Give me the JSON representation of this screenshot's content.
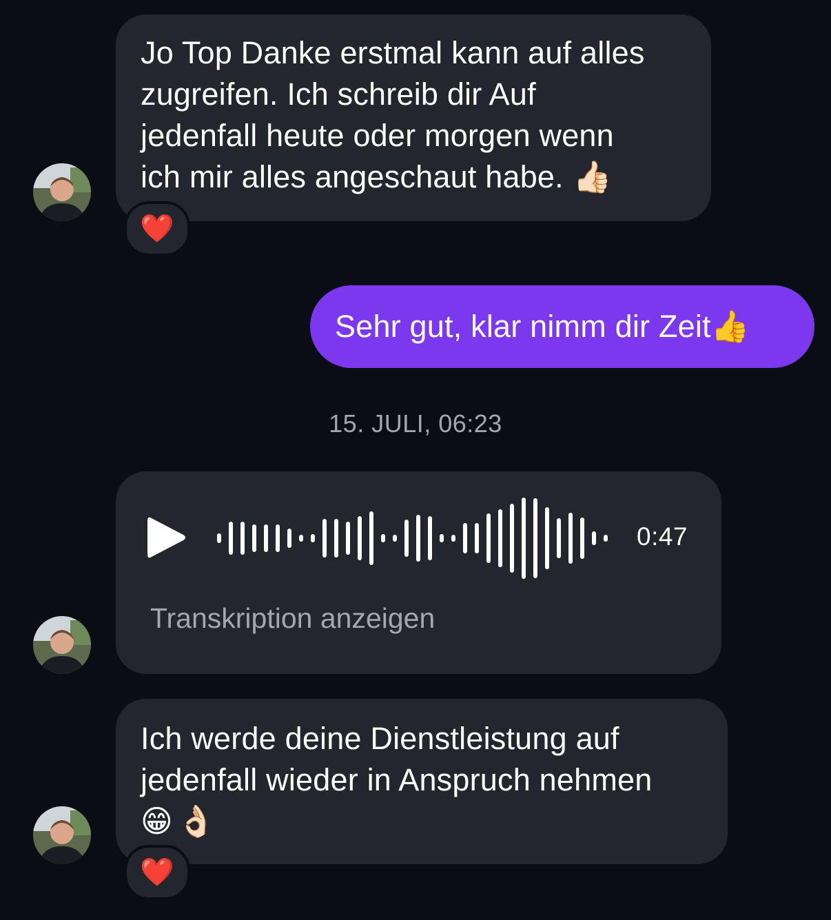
{
  "messages": [
    {
      "text": "Jo Top Danke erstmal kann auf alles\nzugreifen. Ich schreib dir Auf\njedenfall heute oder morgen wenn\nich mir alles angeschaut habe.",
      "emoji": "👍🏻",
      "reaction": "❤️"
    },
    {
      "text": "Sehr gut, klar nimm dir Zeit",
      "emoji": "👍"
    },
    {
      "duration": "0:47",
      "transcription_label": "Transkription anzeigen",
      "play_icon": "play-icon"
    },
    {
      "text": "Ich werde deine Dienstleistung auf\njedenfall wieder in Anspruch nehmen",
      "emoji": "😁👌🏻",
      "reaction": "❤️"
    }
  ],
  "timestamp": "15. JULI, 06:23",
  "colors": {
    "background": "#0b0d14",
    "incoming_bubble": "#24262e",
    "outgoing_bubble": "#7b38ee",
    "reaction_heart": "#e8283a",
    "timestamp_text": "#a3a7b0"
  }
}
